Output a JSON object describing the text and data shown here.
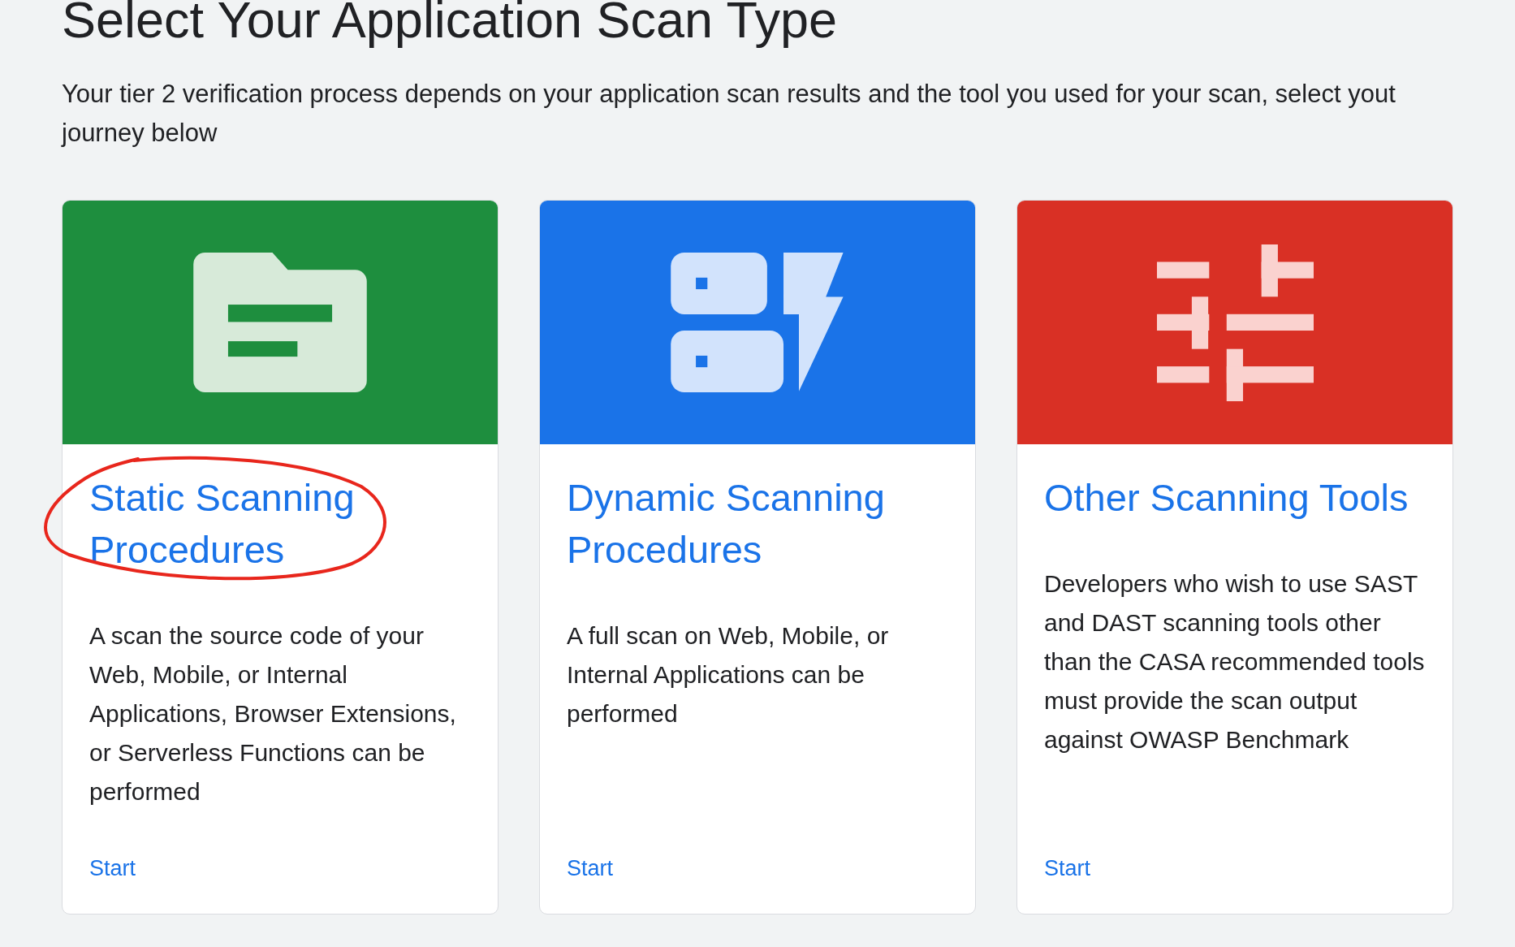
{
  "heading": "Select Your Application Scan Type",
  "intro": "Your tier 2 verification process depends on your application scan results and the tool you used for your scan, select yout journey below",
  "cards": [
    {
      "kind": "static",
      "color": "#1e8e3e",
      "title": "Static Scanning Procedures",
      "circled": true,
      "description": "A scan the source code of your Web, Mobile, or Internal Applications, Browser Extensions, or Serverless Functions can be performed",
      "action": "Start"
    },
    {
      "kind": "dynamic",
      "color": "#1a73e8",
      "title": "Dynamic Scanning Procedures",
      "circled": false,
      "description": "A full scan on Web, Mobile, or Internal Applications can be performed",
      "action": "Start"
    },
    {
      "kind": "other",
      "color": "#d93025",
      "title": "Other Scanning Tools",
      "circled": false,
      "description": "Developers who wish to use SAST and DAST scanning tools other than the CASA recommended tools must provide the scan output against OWASP Benchmark",
      "action": "Start"
    }
  ]
}
